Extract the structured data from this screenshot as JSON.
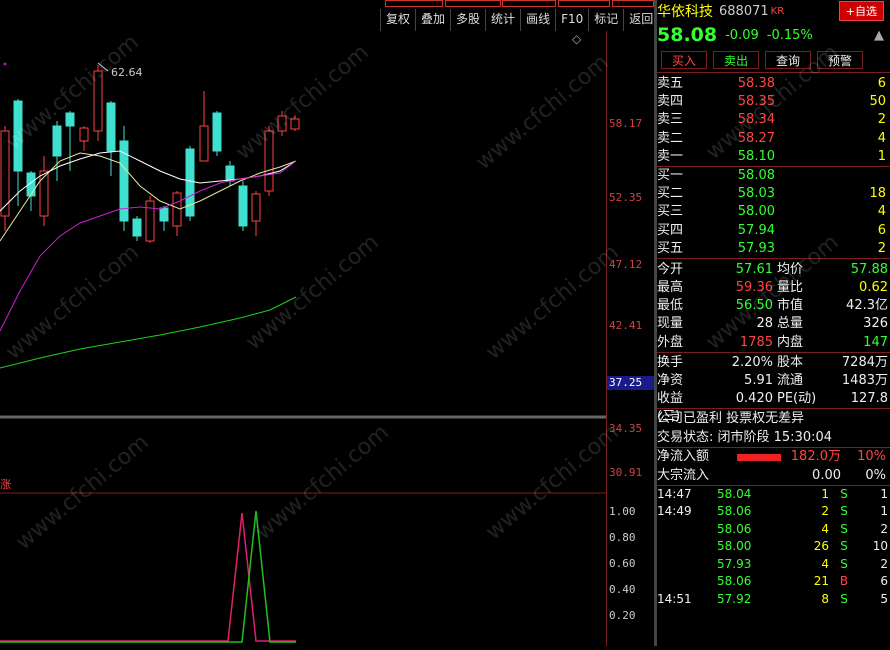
{
  "toolbar": [
    "复权",
    "叠加",
    "多股",
    "统计",
    "画线",
    "F10",
    "标记",
    "返回"
  ],
  "chart": {
    "high_label": "62.64",
    "y_labels": [
      "58.17",
      "52.35",
      "47.12",
      "42.41",
      "37.25",
      "34.35",
      "30.91"
    ],
    "current_price_label": "37.25",
    "indicator_tag": "涨",
    "ind_labels": [
      "1.00",
      "0.80",
      "0.60",
      "0.40",
      "0.20"
    ],
    "diamond": "◇"
  },
  "stock": {
    "name": "华依科技",
    "code": "688071",
    "board": "KR",
    "add_button": "+自选",
    "price": "58.08",
    "change": "-0.09",
    "change_pct": "-0.15%",
    "buttons": [
      "买入",
      "卖出",
      "查询",
      "预警"
    ]
  },
  "orderbook": {
    "asks": [
      {
        "label": "卖五",
        "price": "58.38",
        "vol": "6"
      },
      {
        "label": "卖四",
        "price": "58.35",
        "vol": "50"
      },
      {
        "label": "卖三",
        "price": "58.34",
        "vol": "2"
      },
      {
        "label": "卖二",
        "price": "58.27",
        "vol": "4"
      },
      {
        "label": "卖一",
        "price": "58.10",
        "vol": "1"
      }
    ],
    "bids": [
      {
        "label": "买一",
        "price": "58.08",
        "vol": ""
      },
      {
        "label": "买二",
        "price": "58.03",
        "vol": "18"
      },
      {
        "label": "买三",
        "price": "58.00",
        "vol": "4"
      },
      {
        "label": "买四",
        "price": "57.94",
        "vol": "6"
      },
      {
        "label": "买五",
        "price": "57.93",
        "vol": "2"
      }
    ]
  },
  "stats": [
    {
      "l1": "今开",
      "v1": "57.61",
      "l2": "均价",
      "v2": "57.88"
    },
    {
      "l1": "最高",
      "v1": "59.36",
      "l2": "量比",
      "v2": "0.62"
    },
    {
      "l1": "最低",
      "v1": "56.50",
      "l2": "市值",
      "v2": "42.3亿"
    },
    {
      "l1": "现量",
      "v1": "28",
      "l2": "总量",
      "v2": "326"
    },
    {
      "l1": "外盘",
      "v1": "1785",
      "l2": "内盘",
      "v2": "147"
    }
  ],
  "stats2": [
    {
      "l1": "换手",
      "v1": "2.20%",
      "l2": "股本",
      "v2": "7284万"
    },
    {
      "l1": "净资",
      "v1": "5.91",
      "l2": "流通",
      "v2": "1483万"
    },
    {
      "l1": "收益(三)",
      "v1": "0.420",
      "l2": "PE(动)",
      "v2": "127.8"
    }
  ],
  "notice": "公司已盈利 投票权无差异",
  "trade_status": "交易状态: 闭市阶段 15:30:04",
  "flow": [
    {
      "label": "净流入额",
      "val": "182.0万",
      "pct": "10%"
    },
    {
      "label": "大宗流入",
      "val": "0.00",
      "pct": "0%"
    }
  ],
  "ticks": [
    {
      "t": "14:47",
      "p": "58.04",
      "v": "1",
      "s": "S",
      "n": "1"
    },
    {
      "t": "14:49",
      "p": "58.06",
      "v": "2",
      "s": "S",
      "n": "1"
    },
    {
      "t": "",
      "p": "58.06",
      "v": "4",
      "s": "S",
      "n": "2"
    },
    {
      "t": "",
      "p": "58.00",
      "v": "26",
      "s": "S",
      "n": "10"
    },
    {
      "t": "",
      "p": "57.93",
      "v": "4",
      "s": "S",
      "n": "2"
    },
    {
      "t": "",
      "p": "58.06",
      "v": "21",
      "s": "B",
      "n": "6"
    },
    {
      "t": "14:51",
      "p": "57.92",
      "v": "8",
      "s": "S",
      "n": "5"
    }
  ],
  "watermark": "www.cfchi.com"
}
